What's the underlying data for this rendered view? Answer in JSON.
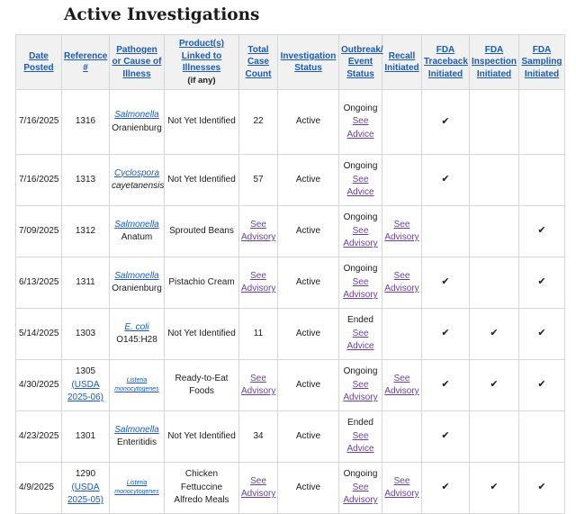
{
  "page_title": "Active Investigations",
  "columns": [
    {
      "label": "Date Posted",
      "link": true
    },
    {
      "label": "Reference #",
      "link": true
    },
    {
      "label": "Pathogen or Cause of Illness",
      "link": true
    },
    {
      "label": "Product(s) Linked to Illnesses",
      "sub": "(if any)",
      "link": true
    },
    {
      "label": "Total Case Count",
      "link": true
    },
    {
      "label": "Investigation Status",
      "link": true
    },
    {
      "label": "Outbreak/ Event Status",
      "link": true
    },
    {
      "label": "Recall Initiated",
      "link": true
    },
    {
      "label": "FDA Traceback Initiated",
      "link": true
    },
    {
      "label": "FDA Inspection Initiated",
      "link": true
    },
    {
      "label": "FDA Sampling Initiated",
      "link": true
    }
  ],
  "check_glyph": "✔",
  "rows": [
    {
      "date": "7/16/2025",
      "ref": "1316",
      "ref_link": "",
      "pathogen": "Salmonella",
      "pathogen_small": false,
      "pathogen_sub": "Oranienburg",
      "pathogen_sub_italic": false,
      "product": "Not Yet Identified",
      "product_link": false,
      "cases": "22",
      "inv_status": "Active",
      "outbreak_status": "Ongoing",
      "advice": "See Advice",
      "recall": "",
      "traceback": true,
      "inspection": false,
      "sampling": false
    },
    {
      "date": "7/16/2025",
      "ref": "1313",
      "ref_link": "",
      "pathogen": "Cyclospora",
      "pathogen_small": false,
      "pathogen_sub": "cayetanensis",
      "pathogen_sub_italic": true,
      "product": "Not Yet Identified",
      "product_link": false,
      "cases": "57",
      "inv_status": "Active",
      "outbreak_status": "Ongoing",
      "advice": "See Advice",
      "recall": "",
      "traceback": true,
      "inspection": false,
      "sampling": false
    },
    {
      "date": "7/09/2025",
      "ref": "1312",
      "ref_link": "",
      "pathogen": "Salmonella",
      "pathogen_small": false,
      "pathogen_sub": "Anatum",
      "pathogen_sub_italic": false,
      "product": "Sprouted Beans",
      "product_link": false,
      "cases": "See Advisory",
      "inv_status": "Active",
      "outbreak_status": "Ongoing",
      "advice": "See Advisory",
      "recall": "See Advisory",
      "traceback": false,
      "inspection": false,
      "sampling": true
    },
    {
      "date": "6/13/2025",
      "ref": "1311",
      "ref_link": "",
      "pathogen": "Salmonella",
      "pathogen_small": false,
      "pathogen_sub": "Oranienburg",
      "pathogen_sub_italic": false,
      "product": "Pistachio Cream",
      "product_link": false,
      "cases": "See Advisory",
      "inv_status": "Active",
      "outbreak_status": "Ongoing",
      "advice": "See Advisory",
      "recall": "See Advisory",
      "traceback": true,
      "inspection": false,
      "sampling": true
    },
    {
      "date": "5/14/2025",
      "ref": "1303",
      "ref_link": "",
      "pathogen": "E. coli",
      "pathogen_small": false,
      "pathogen_sub": "O145:H28",
      "pathogen_sub_italic": false,
      "product": "Not Yet Identified",
      "product_link": false,
      "cases": "11",
      "inv_status": "Active",
      "outbreak_status": "Ended",
      "advice": "See Advice",
      "recall": "",
      "traceback": true,
      "inspection": true,
      "sampling": true
    },
    {
      "date": "4/30/2025",
      "ref": "1305",
      "ref_link": "(USDA 2025-06)",
      "pathogen": "Listeria monocytogenes",
      "pathogen_small": true,
      "pathogen_sub": "",
      "pathogen_sub_italic": false,
      "product": "Ready-to-Eat Foods",
      "product_link": false,
      "cases": "See Advisory",
      "inv_status": "Active",
      "outbreak_status": "Ongoing",
      "advice": "See Advisory",
      "recall": "See Advisory",
      "traceback": true,
      "inspection": true,
      "sampling": true
    },
    {
      "date": "4/23/2025",
      "ref": "1301",
      "ref_link": "",
      "pathogen": "Salmonella",
      "pathogen_small": false,
      "pathogen_sub": "Enteritidis",
      "pathogen_sub_italic": false,
      "product": "Not Yet Identified",
      "product_link": false,
      "cases": "34",
      "inv_status": "Active",
      "outbreak_status": "Ended",
      "advice": "See Advice",
      "recall": "",
      "traceback": true,
      "inspection": false,
      "sampling": false
    },
    {
      "date": "4/9/2025",
      "ref": "1290",
      "ref_link": "(USDA 2025-05)",
      "pathogen": "Listeria monocytogenes",
      "pathogen_small": true,
      "pathogen_sub": "",
      "pathogen_sub_italic": false,
      "product": "Chicken Fettuccine Alfredo Meals",
      "product_link": false,
      "cases": "See Advisory",
      "inv_status": "Active",
      "outbreak_status": "Ongoing",
      "advice": "See Advisory",
      "recall": "See Advisory",
      "traceback": true,
      "inspection": true,
      "sampling": true
    }
  ]
}
